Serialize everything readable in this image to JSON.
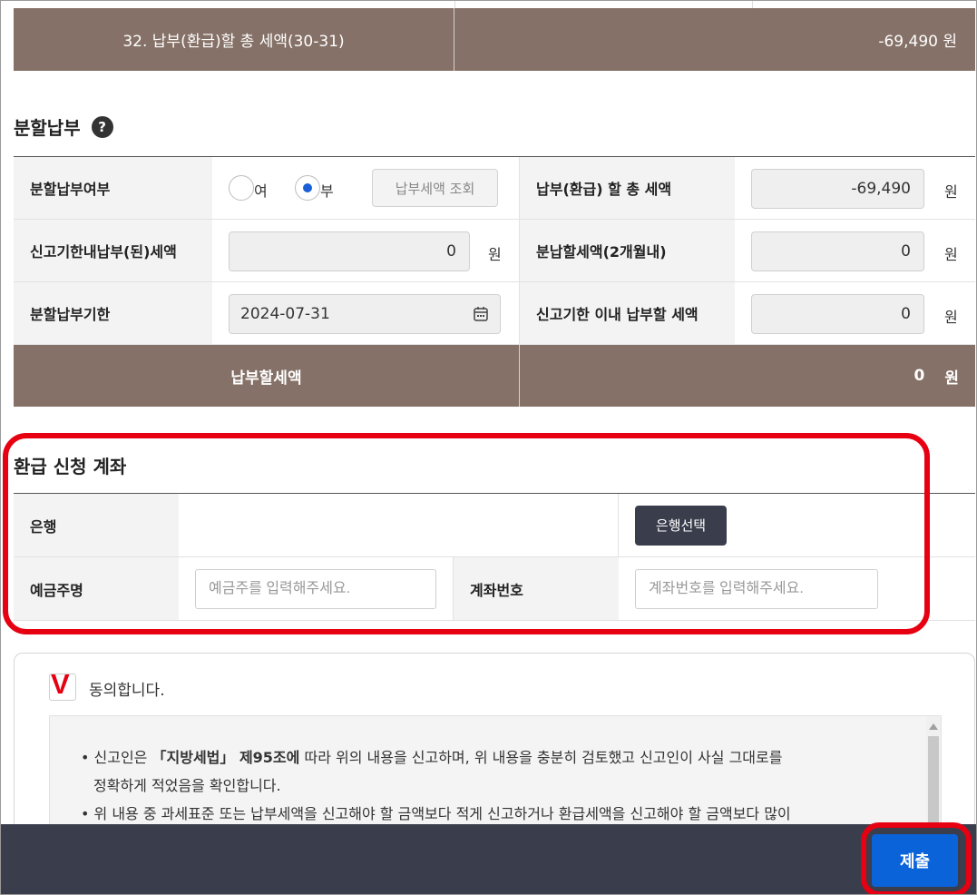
{
  "summary": {
    "total_label": "32. 납부(환급)할 총 세액(30-31)",
    "total_value": "-69,490 원"
  },
  "installment": {
    "title": "분할납부",
    "help_icon": "?",
    "rows": {
      "option_label": "분할납부여부",
      "radio_yes": "여",
      "radio_no": "부",
      "selected": "부",
      "lookup_button": "납부세액 조회",
      "total_tax_label": "납부(환급) 할 총 세액",
      "total_tax_value": "-69,490",
      "paid_in_deadline_label": "신고기한내납부(된)세액",
      "paid_in_deadline_value": "0",
      "split_amount_label": "분납할세액(2개월내)",
      "split_amount_value": "0",
      "due_date_label": "분할납부기한",
      "due_date_value": "2024-07-31",
      "within_deadline_label": "신고기한 이내 납부할 세액",
      "within_deadline_value": "0",
      "unit": "원"
    },
    "pay_row": {
      "label": "납부할세액",
      "value": "0",
      "unit": "원"
    }
  },
  "refund": {
    "title": "환급 신청 계좌",
    "bank_label": "은행",
    "bank_button": "은행선택",
    "holder_label": "예금주명",
    "holder_placeholder": "예금주를 입력해주세요.",
    "account_label": "계좌번호",
    "account_placeholder": "계좌번호를 입력해주세요."
  },
  "consent": {
    "check_mark": "V",
    "agree_label": "동의합니다.",
    "terms": {
      "line1_prefix": "• 신고인은 ",
      "line1_bold": "「지방세법」 제95조에",
      "line1_suffix": " 따라 위의 내용을 신고하며, 위 내용을 충분히 검토했고 신고인이 사실 그대로를",
      "line2": "정확하게 적었음을 확인합니다.",
      "line3": "• 위 내용 중 과세표준 또는 납부세액을 신고해야 할 금액보다 적게 신고하거나 환급세액을 신고해야 할 금액보다 많이"
    }
  },
  "footer": {
    "submit_label": "제출"
  },
  "colors": {
    "header_brown": "#857167",
    "highlight_red": "#e60012",
    "submit_blue": "#0b63d9",
    "footer_dark": "#3a3e4c"
  }
}
